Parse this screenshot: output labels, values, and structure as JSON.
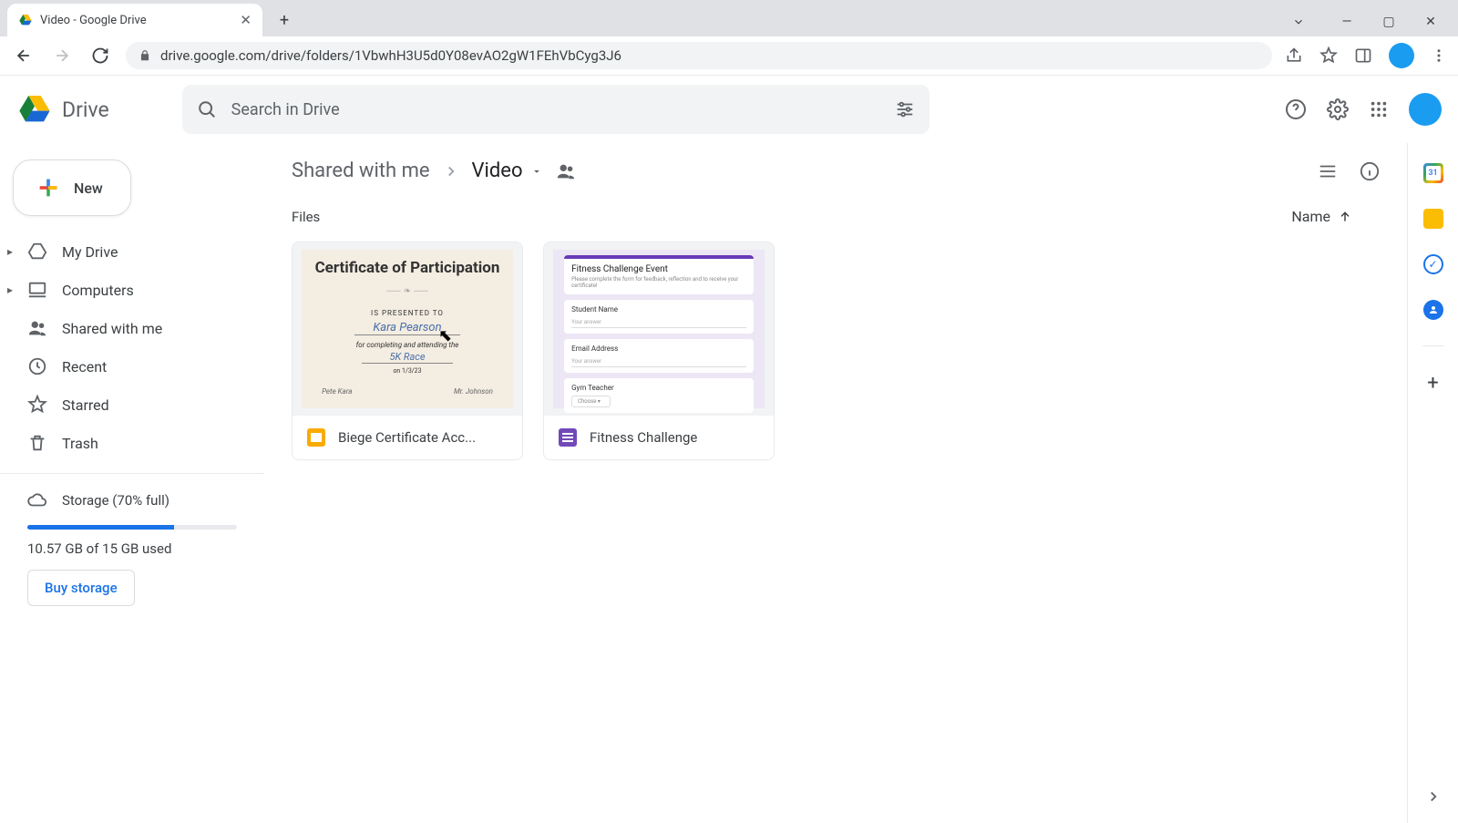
{
  "browser": {
    "tab_title": "Video - Google Drive",
    "url": "drive.google.com/drive/folders/1VbwhH3U5d0Y08evAO2gW1FEhVbCyg3J6"
  },
  "brand": {
    "name": "Drive"
  },
  "search": {
    "placeholder": "Search in Drive"
  },
  "new_button": "New",
  "nav": {
    "my_drive": "My Drive",
    "computers": "Computers",
    "shared": "Shared with me",
    "recent": "Recent",
    "starred": "Starred",
    "trash": "Trash"
  },
  "storage": {
    "label": "Storage (70% full)",
    "percent": 70,
    "used_text": "10.57 GB of 15 GB used",
    "buy": "Buy storage"
  },
  "breadcrumb": {
    "root": "Shared with me",
    "current": "Video"
  },
  "section": {
    "files": "Files"
  },
  "sort": {
    "label": "Name"
  },
  "files": [
    {
      "name": "Biege Certificate Acc...",
      "type": "slides"
    },
    {
      "name": "Fitness Challenge",
      "type": "forms"
    }
  ],
  "thumb_cert": {
    "title": "Certificate of Participation",
    "presented": "IS PRESENTED TO",
    "person": "Kara Pearson",
    "for": "for completing and attending the",
    "event": "5K Race",
    "date": "on 1/3/23",
    "sig_left": "Pete Kara",
    "sig_right": "Mr. Johnson"
  },
  "thumb_form": {
    "title": "Fitness Challenge Event",
    "subtitle": "Please complete the form for feedback, reflection and to receive your certificate!",
    "q1": "Student Name",
    "ph1": "Your answer",
    "q2": "Email Address",
    "ph2": "Your answer",
    "q3": "Gym Teacher",
    "dd": "Choose"
  },
  "rail_cal_day": "31"
}
